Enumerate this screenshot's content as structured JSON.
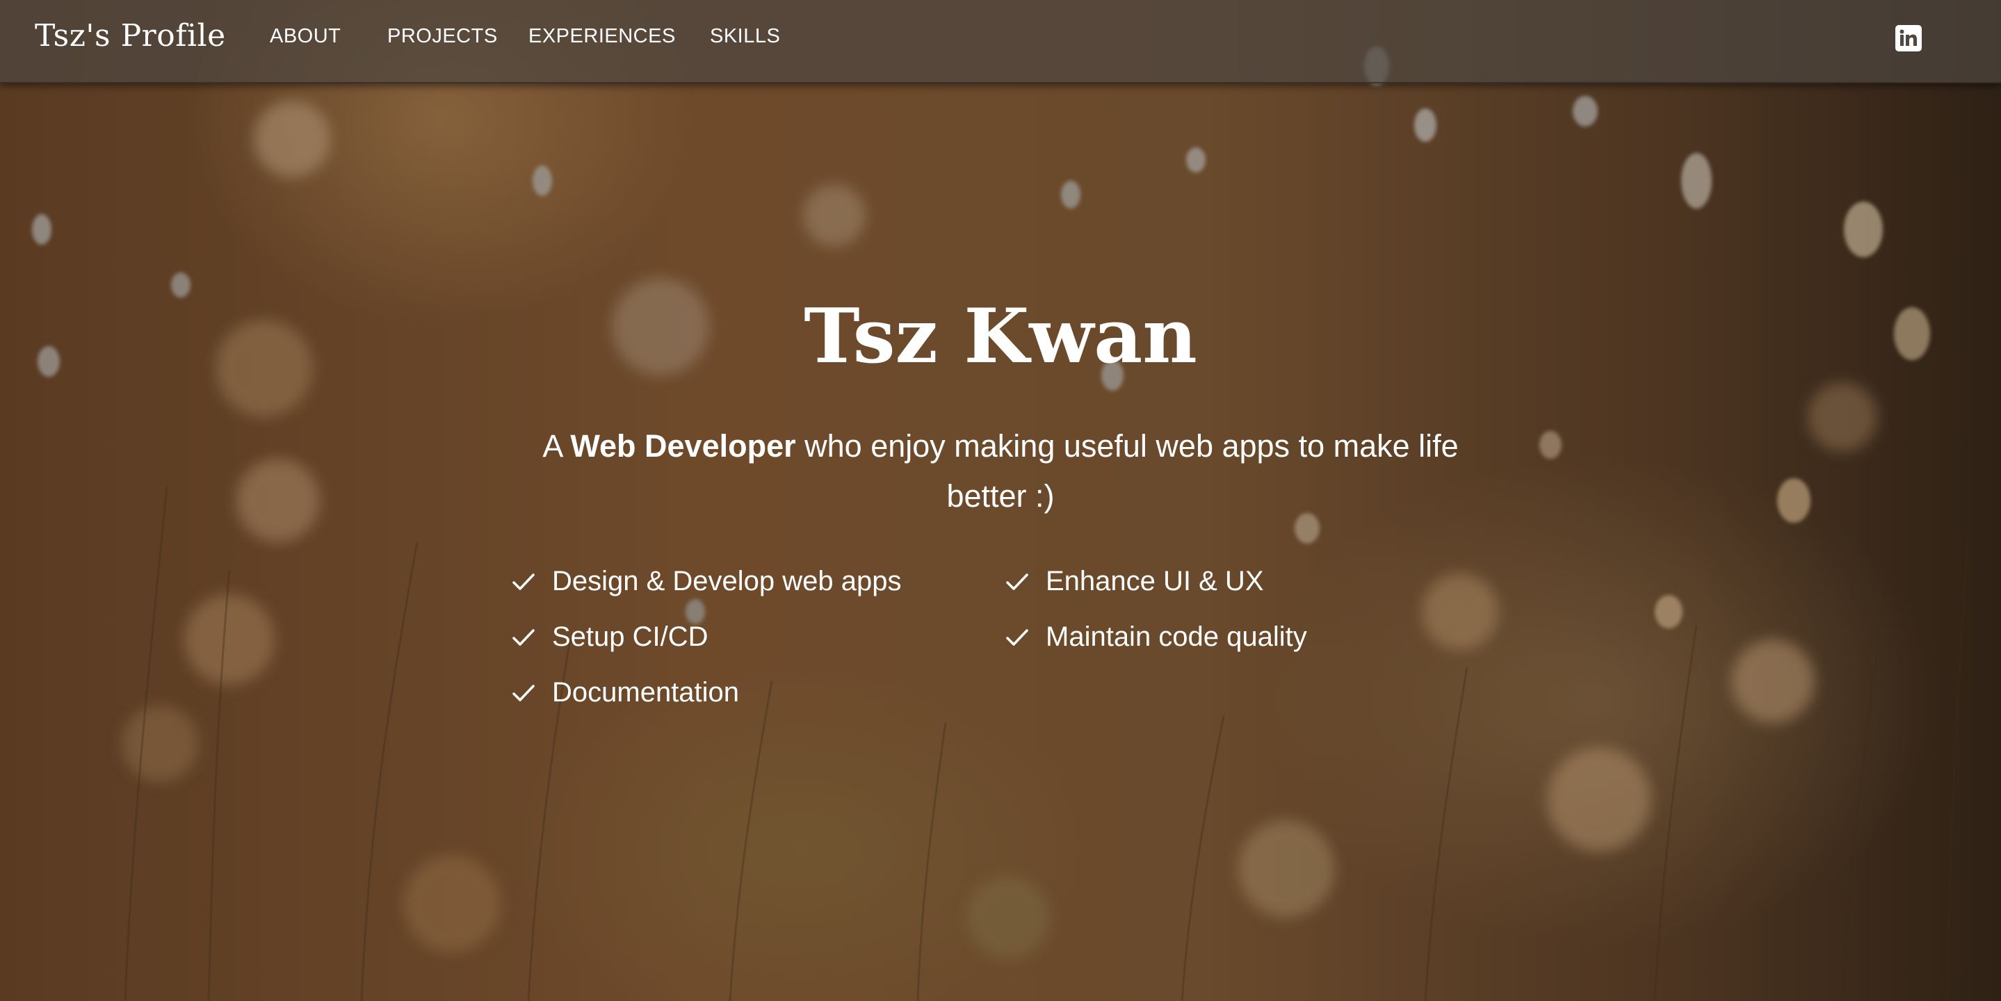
{
  "navbar": {
    "brand": "Tsz's Profile",
    "links": [
      {
        "label": "ABOUT"
      },
      {
        "label": "PROJECTS"
      },
      {
        "label": "EXPERIENCES"
      },
      {
        "label": "SKILLS"
      }
    ],
    "social_icon": "linkedin-icon"
  },
  "hero": {
    "name": "Tsz Kwan",
    "subtitle_prefix": "A ",
    "subtitle_bold": "Web Developer",
    "subtitle_suffix": " who enjoy making useful web apps to make life better :)",
    "check_icon": "check-icon",
    "skills": [
      "Design & Develop web apps",
      "Enhance UI & UX",
      "Setup CI/CD",
      "Maintain code quality",
      "Documentation"
    ]
  },
  "colors": {
    "text": "#ffffff",
    "navbar_bg": "#4e4640",
    "background_warm": "#6e4a2b",
    "background_dark": "#2e2115"
  }
}
